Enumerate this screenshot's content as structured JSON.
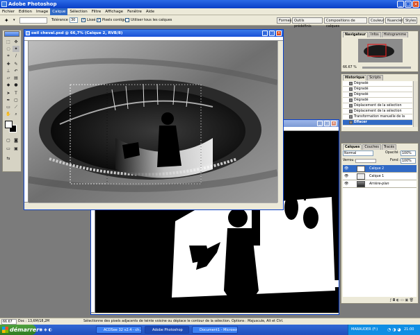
{
  "app": {
    "title": "Adobe Photoshop"
  },
  "menu": [
    "Fichier",
    "Edition",
    "Image",
    "Calque",
    "Sélection",
    "Filtre",
    "Affichage",
    "Fenêtre",
    "Aide"
  ],
  "menu_active_index": 3,
  "options": {
    "tolerance_label": "Tolérance :",
    "tolerance_value": "30",
    "lisse_label": "Lissé",
    "pixels_contigus_label": "Pixels contigus",
    "all_layers_label": "Utiliser tous les calques"
  },
  "palette_well": [
    "Formes",
    "Outils prédéfinis",
    "Compositions de calques",
    "Couleur",
    "Nuancier",
    "Styles"
  ],
  "doc_main": {
    "title": "oeil cheval.psd @ 66,7% (Calque 2, RVB/8)"
  },
  "navigator": {
    "tabs": [
      "Navigateur",
      "Infos",
      "Histogramme"
    ],
    "zoom": "66.67 %"
  },
  "history": {
    "tabs": [
      "Historique",
      "Scripts"
    ],
    "rows": [
      "Dégradé",
      "Dégradé",
      "Dégradé",
      "Dégradé",
      "Déplacement de la sélection",
      "Déplacement de la sélection",
      "Transformation manuelle de la sél...",
      "Effacer"
    ]
  },
  "layers": {
    "tabs": [
      "Calques",
      "Couches",
      "Tracés"
    ],
    "blend_mode": "Normal",
    "opacity_label": "Opacité :",
    "opacity": "100%",
    "lock_label": "Verrou :",
    "fill_label": "Fond :",
    "fill": "100%",
    "rows": [
      "Calque 2",
      "Calque 1",
      "Arrière-plan"
    ],
    "selected_index": 0
  },
  "status": {
    "zoom": "66.67 %",
    "doc": "Doc : 13,6M/18,2M",
    "hint": "Sélectionne des pixels adjacents de teinte voisine ou déplace le contour de la sélection. Options : Majuscule, Alt et Ctrl."
  },
  "taskbar": {
    "start": "démarrer",
    "tasks": [
      "ACDSee 32 v2.4 - ch...",
      "Adobe Photoshop",
      "Document1 - Microsof..."
    ],
    "active_index": 1,
    "tray_text": "MARAUDER (F:)",
    "clock": "21:00"
  },
  "icons": [
    "photoshop-app-icon",
    "minimize-icon",
    "maximize-icon",
    "close-icon",
    "magic-wand-icon",
    "marquee-icon",
    "lasso-icon",
    "crop-icon",
    "brush-icon",
    "eraser-icon",
    "gradient-icon",
    "text-icon",
    "hand-icon",
    "zoom-icon",
    "eye-icon",
    "trash-icon",
    "new-layer-icon"
  ],
  "colors": {
    "xp_blue": "#0a3fc6",
    "selection": "#316ac5",
    "start_green": "#3f8f30"
  }
}
